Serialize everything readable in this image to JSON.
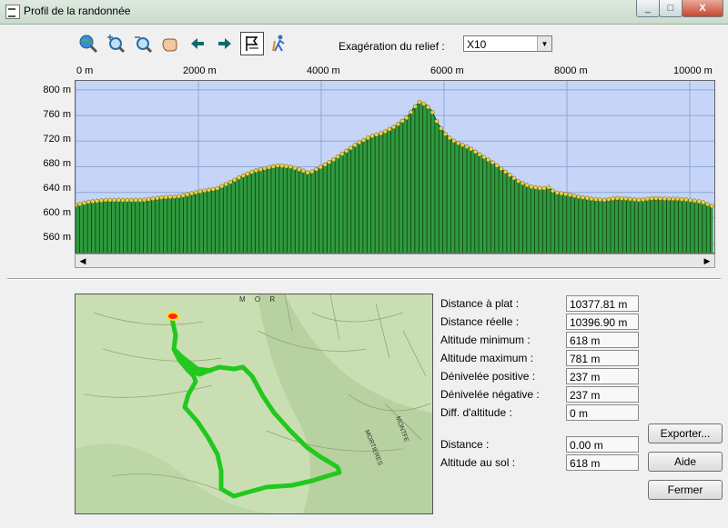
{
  "window": {
    "title": "Profil de la randonnée",
    "controls": [
      "_",
      "□",
      "X"
    ]
  },
  "toolbar": {
    "icons": [
      "globe-zoom-icon",
      "zoom-in-icon",
      "zoom-out-icon",
      "hand-pan-icon",
      "arrow-left-icon",
      "arrow-right-icon",
      "flag-icon",
      "hiker-icon"
    ],
    "exag_label": "Exagération du relief :",
    "exag_value": "X10"
  },
  "chart_data": {
    "type": "area",
    "xlabel": "",
    "ylabel": "",
    "x_ticks": [
      "0 m",
      "2000 m",
      "4000 m",
      "6000 m",
      "8000 m",
      "10000 m"
    ],
    "y_ticks": [
      "800 m",
      "760 m",
      "720 m",
      "680 m",
      "640 m",
      "600 m",
      "560 m"
    ],
    "xlim": [
      0,
      10400
    ],
    "ylim": [
      546,
      814
    ],
    "grid": true,
    "fill_color": "#2f9a3e",
    "bg_color": "#c6d5f7",
    "marker_color": "#e6d24a",
    "x": [
      0,
      200,
      500,
      800,
      1100,
      1400,
      1700,
      2000,
      2300,
      2500,
      2700,
      2900,
      3100,
      3300,
      3500,
      3700,
      3800,
      4000,
      4200,
      4400,
      4600,
      4800,
      5000,
      5200,
      5400,
      5500,
      5600,
      5700,
      5800,
      5900,
      6000,
      6100,
      6200,
      6400,
      6600,
      6800,
      7000,
      7200,
      7400,
      7600,
      7700,
      7800,
      8000,
      8200,
      8400,
      8600,
      8800,
      9000,
      9200,
      9400,
      9600,
      9800,
      10000,
      10200,
      10378
    ],
    "y": [
      620,
      625,
      628,
      628,
      628,
      632,
      634,
      641,
      646,
      655,
      665,
      673,
      678,
      682,
      680,
      674,
      670,
      680,
      691,
      704,
      717,
      727,
      733,
      743,
      757,
      771,
      781,
      777,
      767,
      747,
      733,
      724,
      718,
      710,
      698,
      686,
      672,
      658,
      649,
      646,
      648,
      640,
      637,
      633,
      630,
      628,
      631,
      630,
      628,
      631,
      630,
      630,
      628,
      625,
      618
    ]
  },
  "stats": [
    {
      "label": "Distance à plat :",
      "value": "10377.81 m"
    },
    {
      "label": "Distance réelle :",
      "value": "10396.90 m"
    },
    {
      "label": "Altitude minimum :",
      "value": "618 m"
    },
    {
      "label": "Altitude maximum :",
      "value": "781 m"
    },
    {
      "label": "Dénivelée positive :",
      "value": "237 m"
    },
    {
      "label": "Dénivelée négative :",
      "value": "237 m"
    },
    {
      "label": "Diff. d'altitude :",
      "value": "0 m"
    }
  ],
  "cursor": [
    {
      "label": "Distance :",
      "value": "0.00 m"
    },
    {
      "label": "Altitude au sol :",
      "value": "618 m"
    }
  ],
  "buttons": {
    "export": "Exporter...",
    "help": "Aide",
    "close": "Fermer"
  },
  "map": {
    "labels": [
      "M O R",
      "MONTFE",
      "MORTIERES"
    ]
  }
}
